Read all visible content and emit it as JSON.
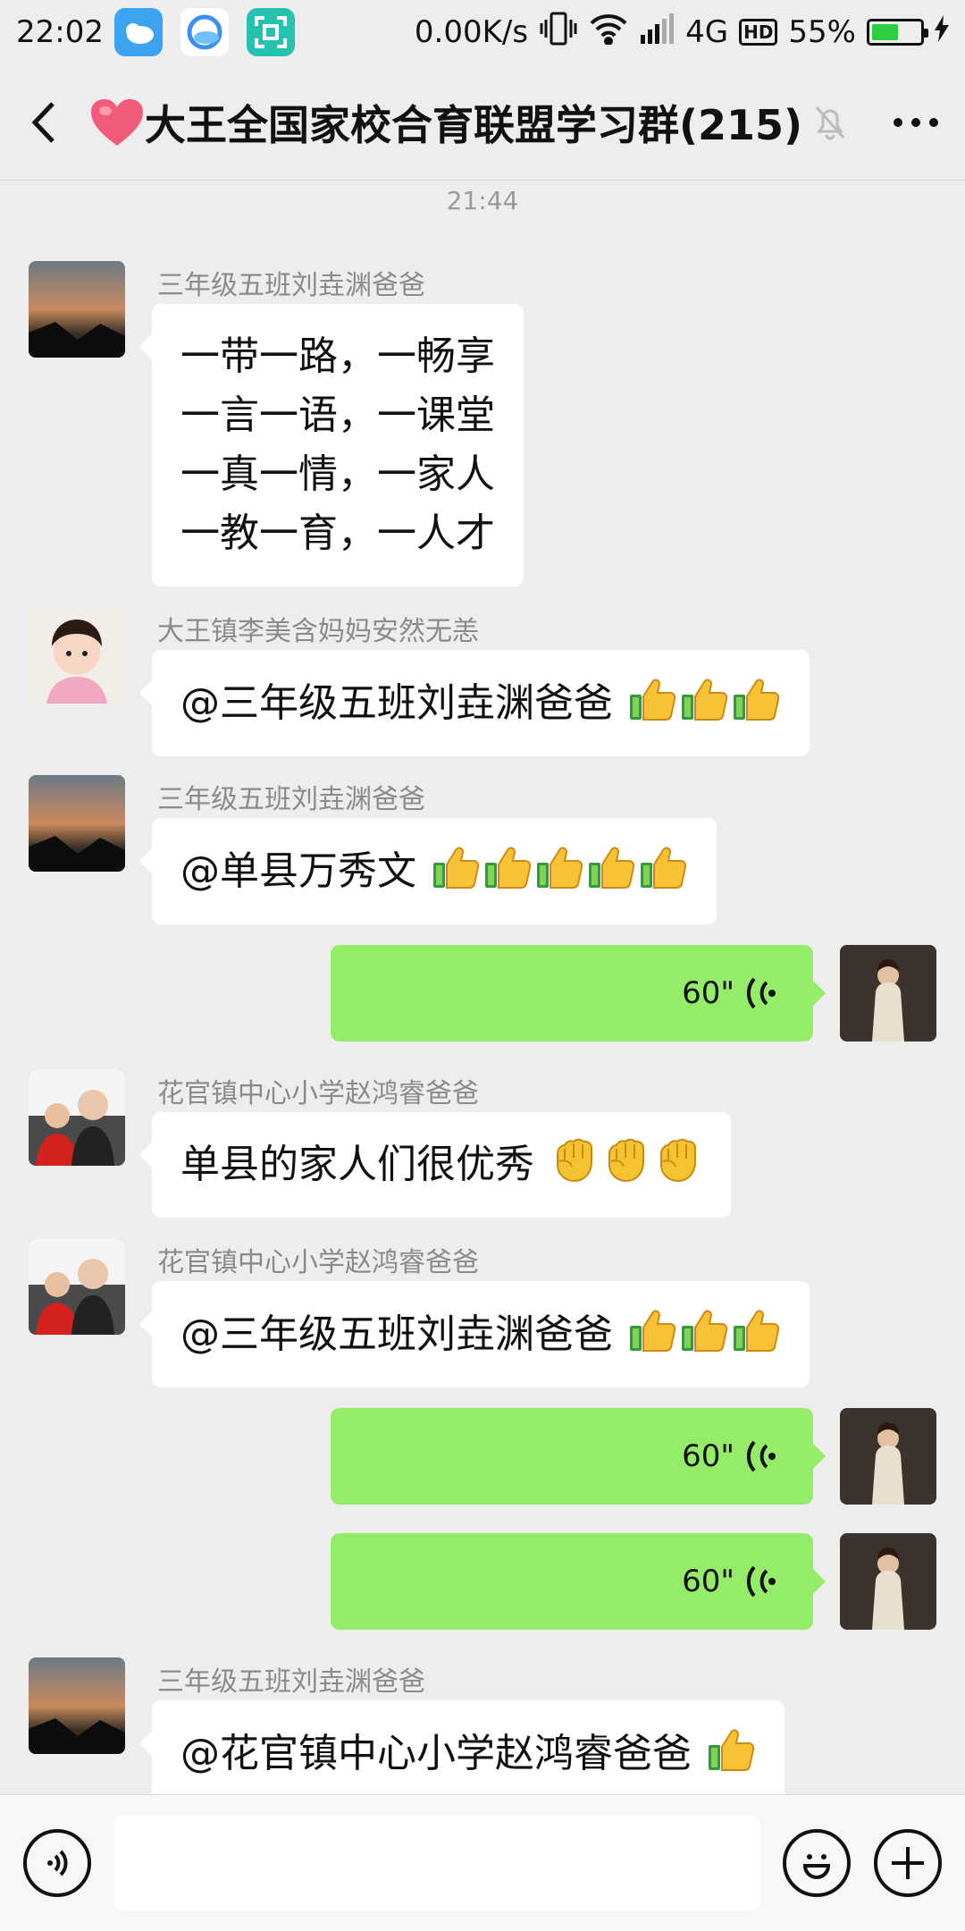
{
  "status_bar": {
    "time": "22:02",
    "net_speed": "0.00K/s",
    "network": "4G",
    "hd": "HD",
    "battery_percent": "55%",
    "battery_level": 0.55
  },
  "header": {
    "back_icon": "chevron-left-icon",
    "title": "大王全国家校合育联盟学习群(215)",
    "mute_icon": "bell-mute-icon",
    "more_icon": "ellipsis-icon"
  },
  "chat": {
    "timestamp": "21:44",
    "messages": [
      {
        "sender": "三年级五班刘垚渊爸爸",
        "lines": [
          "一带一路，一畅享",
          "一言一语，一课堂",
          "一真一情，一家人",
          "一教一育，一人才"
        ]
      },
      {
        "sender": "大王镇李美含妈妈安然无恙",
        "text": "@三年级五班刘垚渊爸爸",
        "thumbs": 3
      },
      {
        "sender": "三年级五班刘垚渊爸爸",
        "text": "@单县万秀文",
        "thumbs": 5
      },
      {
        "voice": "60\""
      },
      {
        "sender": "花官镇中心小学赵鸿睿爸爸",
        "text": "单县的家人们很优秀",
        "fists": 3
      },
      {
        "sender": "花官镇中心小学赵鸿睿爸爸",
        "text": "@三年级五班刘垚渊爸爸",
        "thumbs": 3
      },
      {
        "voice": "60\""
      },
      {
        "voice": "60\""
      },
      {
        "sender": "三年级五班刘垚渊爸爸",
        "text": "@花官镇中心小学赵鸿睿爸爸",
        "thumbs": 1
      }
    ]
  },
  "input_bar": {
    "voice_icon": "voice-input-icon",
    "emoji_icon": "emoji-icon",
    "plus_icon": "plus-icon",
    "input_value": ""
  },
  "colors": {
    "background": "#ededed",
    "voice_bubble": "#95ec69",
    "text_bubble": "#ffffff"
  }
}
